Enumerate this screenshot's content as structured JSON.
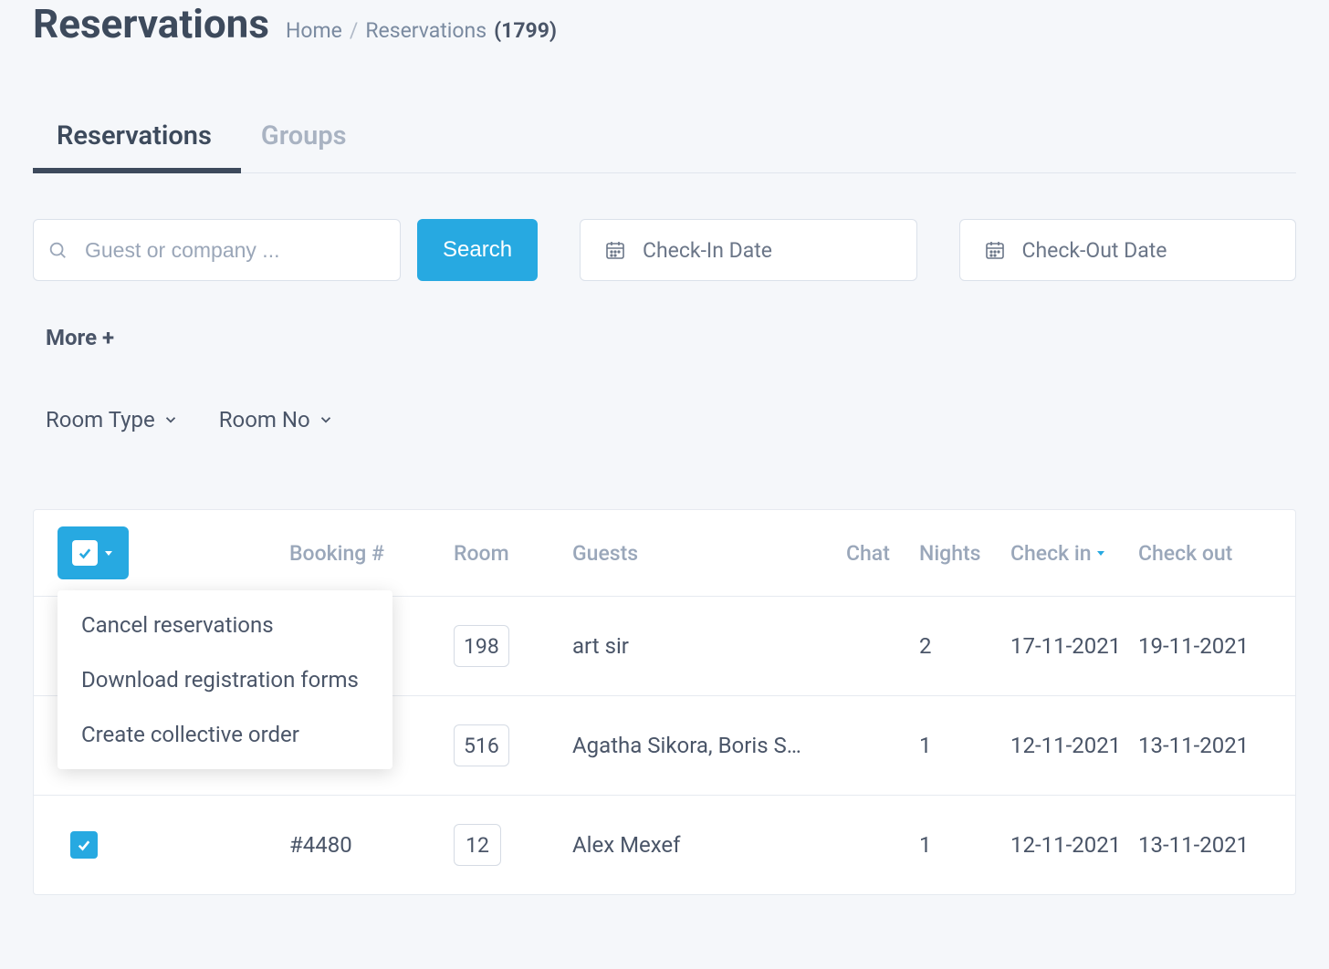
{
  "header": {
    "title": "Reservations",
    "breadcrumb_home": "Home",
    "breadcrumb_current": "Reservations",
    "count": "(1799)"
  },
  "tabs": {
    "reservations": "Reservations",
    "groups": "Groups"
  },
  "filters": {
    "search_placeholder": "Guest or company ...",
    "search_button": "Search",
    "checkin_label": "Check-In Date",
    "checkout_label": "Check-Out Date",
    "more_label": "More +",
    "room_type_label": "Room Type",
    "room_no_label": "Room No"
  },
  "table": {
    "headers": {
      "booking": "Booking #",
      "room": "Room",
      "guests": "Guests",
      "chat": "Chat",
      "nights": "Nights",
      "check_in": "Check in",
      "check_out": "Check out"
    },
    "rows": [
      {
        "booking": "",
        "room": "198",
        "guests": "art sir",
        "chat": "",
        "nights": "2",
        "check_in": "17-11-2021",
        "check_out": "19-11-2021"
      },
      {
        "booking": "",
        "room": "516",
        "guests": "Agatha Sikora, Boris S…",
        "chat": "",
        "nights": "1",
        "check_in": "12-11-2021",
        "check_out": "13-11-2021"
      },
      {
        "booking": "#4480",
        "room": "12",
        "guests": "Alex Mexef",
        "chat": "",
        "nights": "1",
        "check_in": "12-11-2021",
        "check_out": "13-11-2021"
      }
    ]
  },
  "bulk_menu": {
    "cancel": "Cancel reservations",
    "download": "Download registration forms",
    "collective": "Create collective order"
  }
}
